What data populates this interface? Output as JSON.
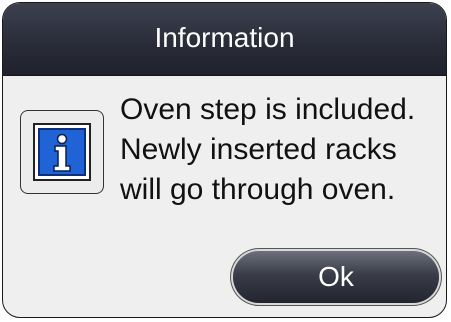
{
  "dialog": {
    "title": "Information",
    "icon": "info-icon",
    "message_lines": [
      "Oven step is included.",
      "Newly inserted racks",
      "will go through oven."
    ],
    "ok_label": "Ok"
  },
  "colors": {
    "titlebar": "#2a2d39",
    "body_background": "#efefef",
    "icon_blue": "#1f63d6",
    "button_dark": "#2a2d37"
  }
}
